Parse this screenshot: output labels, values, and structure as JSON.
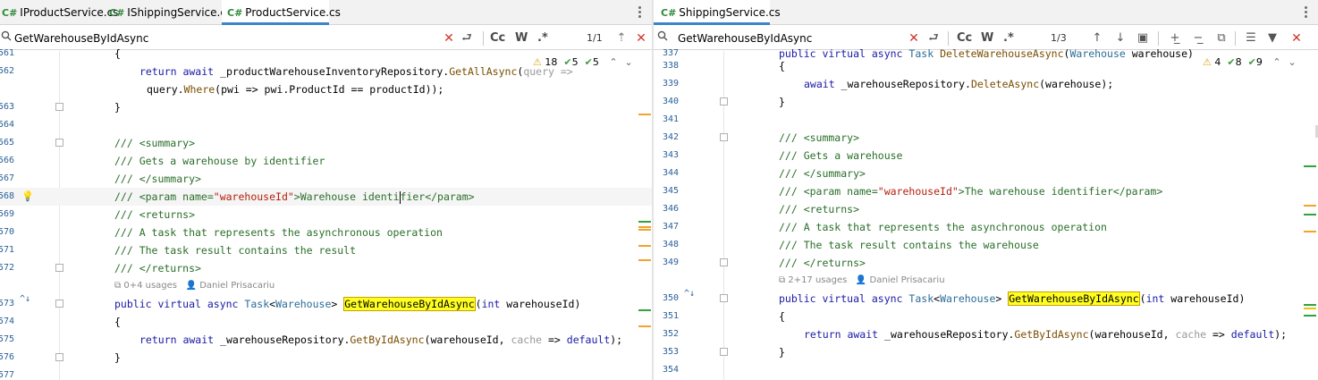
{
  "left": {
    "tabs": [
      {
        "icon": "C#",
        "label": "IProductService.cs",
        "active": false
      },
      {
        "icon": "C#",
        "label": "IShippingService.cs",
        "active": false
      },
      {
        "icon": "C#",
        "label": "ProductService.cs",
        "active": true
      }
    ],
    "search": {
      "value": "GetWarehouseByIdAsync",
      "count": "1/1",
      "match_case": "Cc",
      "words": "W",
      "regex": ".*"
    },
    "inspection": {
      "warnings": "18",
      "weak": "5",
      "info": "5"
    },
    "lines": [
      {
        "n": "561",
        "text": "{"
      },
      {
        "n": "562",
        "text": "return await _productWarehouseInventoryRepository.GetAllAsync(query =>"
      },
      {
        "n": "",
        "text": "query.Where(pwi => pwi.ProductId == productId));"
      },
      {
        "n": "563",
        "text": "}"
      },
      {
        "n": "564",
        "text": ""
      },
      {
        "n": "565",
        "text": "/// <summary>"
      },
      {
        "n": "566",
        "text": "/// Gets a warehouse by identifier"
      },
      {
        "n": "567",
        "text": "/// </summary>"
      },
      {
        "n": "568",
        "text": "/// <param name=\"warehouseId\">Warehouse identifier</param>"
      },
      {
        "n": "569",
        "text": "/// <returns>"
      },
      {
        "n": "570",
        "text": "/// A task that represents the asynchronous operation"
      },
      {
        "n": "571",
        "text": "/// The task result contains the result"
      },
      {
        "n": "572",
        "text": "/// </returns>"
      },
      {
        "n": "573",
        "text": "public virtual async Task<Warehouse> GetWarehouseByIdAsync(int warehouseId)"
      },
      {
        "n": "574",
        "text": "{"
      },
      {
        "n": "575",
        "text": "return await _warehouseRepository.GetByIdAsync(warehouseId, cache => default);"
      },
      {
        "n": "576",
        "text": "}"
      },
      {
        "n": "577",
        "text": ""
      }
    ],
    "lens": {
      "usages": "0+4 usages",
      "author": "Daniel Prisacariu"
    }
  },
  "right": {
    "tabs": [
      {
        "icon": "C#",
        "label": "ShippingService.cs",
        "active": true
      }
    ],
    "search": {
      "value": "GetWarehouseByIdAsync",
      "count": "1/3",
      "match_case": "Cc",
      "words": "W",
      "regex": ".*"
    },
    "inspection": {
      "warnings": "4",
      "weak": "8",
      "info": "9"
    },
    "lines": [
      {
        "n": "337",
        "text": "public virtual async Task DeleteWarehouseAsync(Warehouse warehouse)"
      },
      {
        "n": "338",
        "text": "{"
      },
      {
        "n": "339",
        "text": "await _warehouseRepository.DeleteAsync(warehouse);"
      },
      {
        "n": "340",
        "text": "}"
      },
      {
        "n": "341",
        "text": ""
      },
      {
        "n": "342",
        "text": "/// <summary>"
      },
      {
        "n": "343",
        "text": "/// Gets a warehouse"
      },
      {
        "n": "344",
        "text": "/// </summary>"
      },
      {
        "n": "345",
        "text": "/// <param name=\"warehouseId\">The warehouse identifier</param>"
      },
      {
        "n": "346",
        "text": "/// <returns>"
      },
      {
        "n": "347",
        "text": "/// A task that represents the asynchronous operation"
      },
      {
        "n": "348",
        "text": "/// The task result contains the warehouse"
      },
      {
        "n": "349",
        "text": "/// </returns>"
      },
      {
        "n": "350",
        "text": "public virtual async Task<Warehouse> GetWarehouseByIdAsync(int warehouseId)"
      },
      {
        "n": "351",
        "text": "{"
      },
      {
        "n": "352",
        "text": "return await _warehouseRepository.GetByIdAsync(warehouseId, cache => default);"
      },
      {
        "n": "353",
        "text": "}"
      },
      {
        "n": "354",
        "text": ""
      }
    ],
    "lens": {
      "usages": "2+17 usages",
      "author": "Daniel Prisacariu"
    }
  },
  "colors": {
    "accent": "#4083c9",
    "highlight": "#ffff22",
    "comment": "#2a6e2a",
    "keyword": "#1a1aa6",
    "string": "#b5200d",
    "line_number": "#2a6099"
  },
  "icons": [
    "csharp-file-icon",
    "search-icon",
    "clear-icon",
    "replace-toggle-icon",
    "match-case-icon",
    "words-icon",
    "regex-icon",
    "close-icon",
    "warning-icon",
    "check-icon",
    "chevron-up-icon",
    "chevron-down-icon",
    "arrow-up-icon",
    "arrow-down-icon",
    "select-all-icon",
    "add-selection-icon",
    "remove-selection-icon",
    "filter-icon",
    "bulb-icon"
  ]
}
